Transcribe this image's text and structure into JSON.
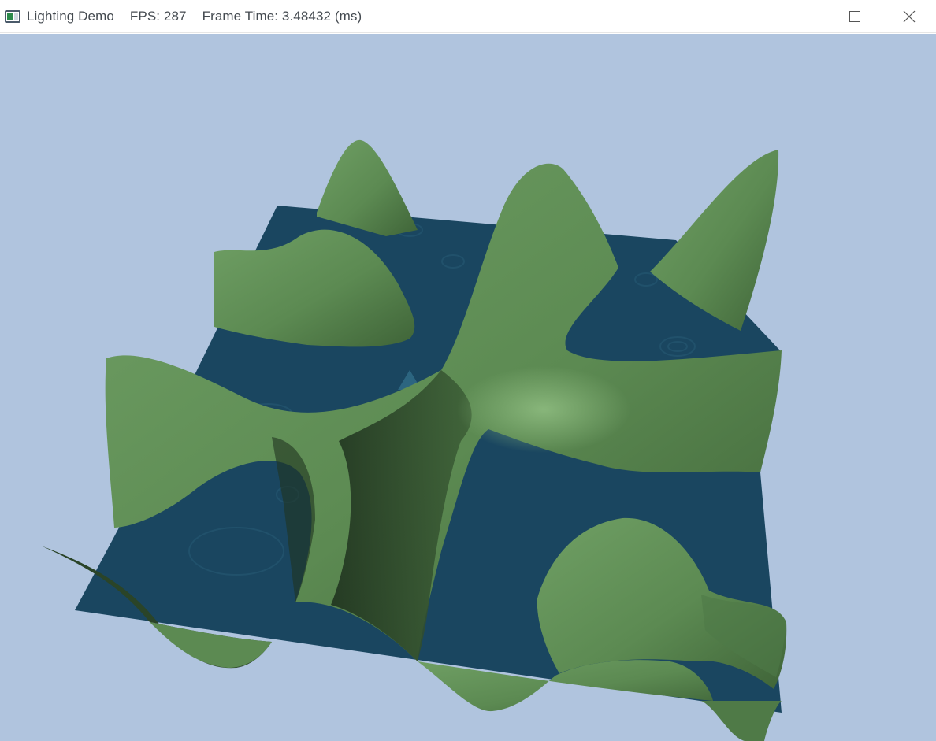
{
  "window": {
    "app_title": "Lighting Demo",
    "fps_text": "FPS: 287",
    "frame_time_text": "Frame Time: 3.48432 (ms)",
    "icon": "app-window-icon",
    "controls": {
      "minimize_icon": "minimize-icon",
      "maximize_icon": "maximize-icon",
      "close_icon": "close-icon"
    }
  },
  "scene": {
    "background_color": "#b0c4de",
    "water_color": "#1a4660",
    "terrain_color": "#5f8f56",
    "terrain_shadow_color": "#1f3320"
  }
}
